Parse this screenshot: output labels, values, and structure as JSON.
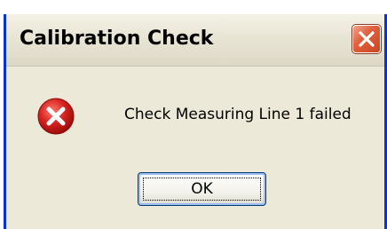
{
  "dialog": {
    "title": "Calibration Check",
    "message": "Check Measuring Line 1 failed",
    "ok_label": "OK",
    "icon": "error-icon",
    "close_icon": "close-icon"
  },
  "colors": {
    "frame_blue": "#0831d9",
    "dialog_bg": "#ece9d8",
    "error_red": "#d7231f",
    "close_red": "#e0613f"
  }
}
